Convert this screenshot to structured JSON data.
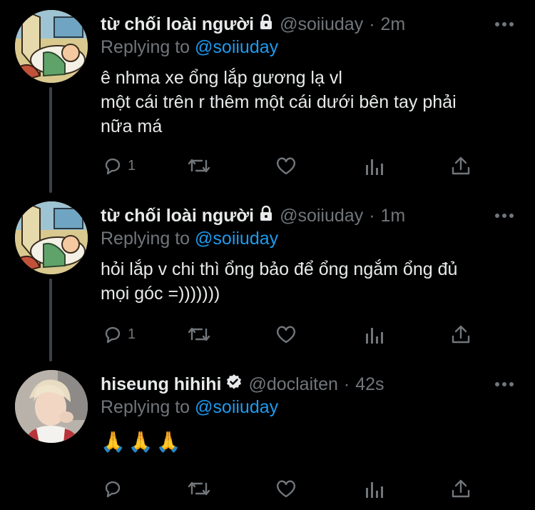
{
  "thread": [
    {
      "author_name": "từ chối loài người",
      "locked": true,
      "handle": "@soiiuday",
      "separator": "·",
      "time": "2m",
      "reply_prefix": "Replying to",
      "reply_to": "@soiiuday",
      "body_lines": [
        "ê nhma xe ổng lắp gương lạ vl",
        "một cái trên r thêm một cái dưới bên tay phải",
        "nữa má"
      ],
      "reply_count": "1",
      "avatar_icon": "cartoon-sleeping-kid-avatar"
    },
    {
      "author_name": "từ chối loài người",
      "locked": true,
      "handle": "@soiiuday",
      "separator": "·",
      "time": "1m",
      "reply_prefix": "Replying to",
      "reply_to": "@soiiuday",
      "body_lines": [
        "hỏi lắp v chi thì ổng bảo để ổng ngắm ổng đủ",
        "mọi góc =)))))))"
      ],
      "reply_count": "1",
      "avatar_icon": "cartoon-sleeping-kid-avatar"
    },
    {
      "author_name": "hiseung hihihi",
      "verified": true,
      "handle": "@doclaiten",
      "separator": "·",
      "time": "42s",
      "reply_prefix": "Replying to",
      "reply_to": "@soiiuday",
      "body_lines": [
        "🙏🙏🙏"
      ],
      "reply_count": "",
      "avatar_icon": "person-photo-avatar"
    }
  ],
  "icons": {
    "reply": "reply-icon",
    "retweet": "retweet-icon",
    "like": "heart-icon",
    "views": "analytics-icon",
    "share": "share-icon",
    "more": "more-icon"
  },
  "colors": {
    "background": "#000000",
    "text": "#e7e9ea",
    "muted": "#71767b",
    "link": "#1d9bf0",
    "thread_line": "#3d4145"
  }
}
